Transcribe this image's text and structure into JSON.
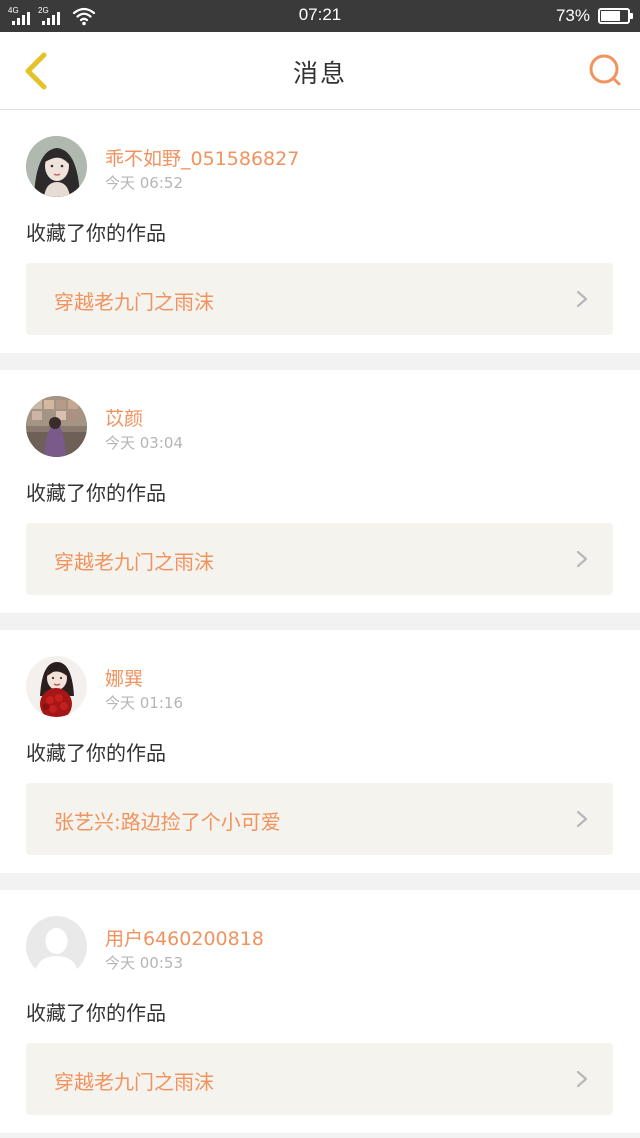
{
  "status_bar": {
    "network1": "4G",
    "network2": "2G",
    "time": "07:21",
    "battery_text": "73%",
    "battery_level": 0.73
  },
  "nav": {
    "title": "消息",
    "back_icon": "chevron-left-icon",
    "search_icon": "search-icon",
    "accent_color": "#f0935f",
    "back_color": "#e6c229"
  },
  "messages": [
    {
      "username": "乖不如野_051586827",
      "time": "今天 06:52",
      "action": "收藏了你的作品",
      "work_title": "穿越老九门之雨沫",
      "avatar": "avatar-photo-girl"
    },
    {
      "username": "苡颜",
      "time": "今天 03:04",
      "action": "收藏了你的作品",
      "work_title": "穿越老九门之雨沫",
      "avatar": "avatar-photo-room"
    },
    {
      "username": "娜巽",
      "time": "今天 01:16",
      "action": "收藏了你的作品",
      "work_title": "张艺兴:路边捡了个小可爱",
      "avatar": "avatar-photo-roses"
    },
    {
      "username": "用户6460200818",
      "time": "今天 00:53",
      "action": "收藏了你的作品",
      "work_title": "穿越老九门之雨沫",
      "avatar": "avatar-default"
    }
  ]
}
